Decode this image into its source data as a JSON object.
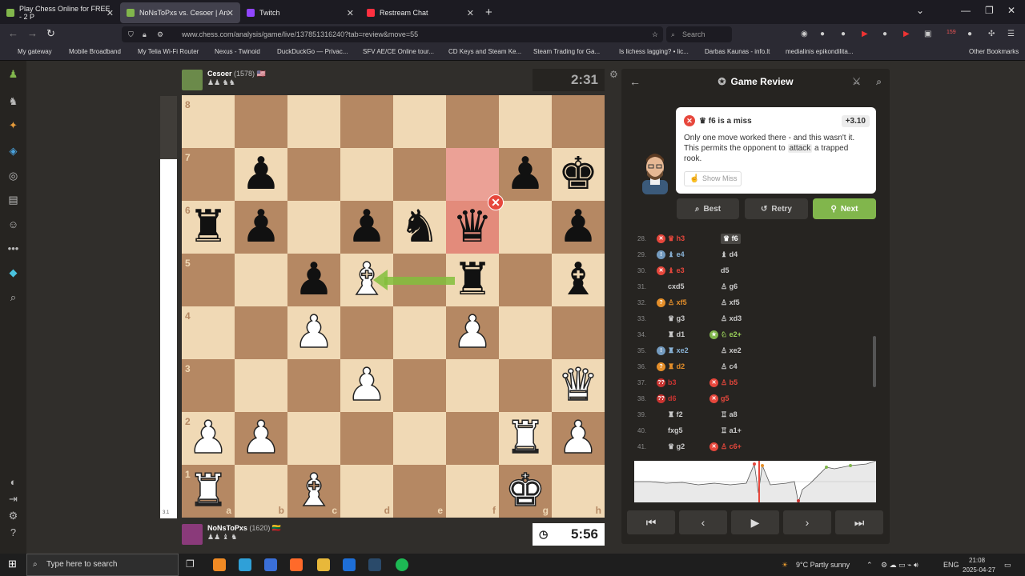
{
  "browser": {
    "tabs": [
      {
        "label": "Play Chess Online for FREE - 2 P",
        "active": false,
        "favicon_color": "#81b64c"
      },
      {
        "label": "NoNsToPxs vs. Cesoer | An",
        "active": true,
        "favicon_color": "#81b64c"
      },
      {
        "label": "Twitch",
        "active": false,
        "favicon_color": "#9146ff"
      },
      {
        "label": "Restream Chat",
        "active": false,
        "favicon_color": "#ff3040"
      }
    ],
    "new_tab": "+",
    "url": "www.chess.com/analysis/game/live/137851316240?tab=review&move=55",
    "search_placeholder": "Search",
    "bookmarks": [
      "My gateway",
      "Mobile Broadband",
      "My Telia Wi-Fi Router",
      "Nexus - Twinoid",
      "DuckDuckGo — Privac...",
      "SFV AE/CE Online tour...",
      "CD Keys and Steam Ke...",
      "Steam Trading for Ga...",
      "Is lichess lagging? • lic...",
      "Darbas Kaunas - info.lt",
      "medialinis epikondilita...",
      "Other Bookmarks"
    ],
    "toolbar_badge": "159"
  },
  "game": {
    "top_player": {
      "name": "Cesoer",
      "rating": "(1578)",
      "flag": "🇺🇸",
      "material": "♟♟ ♞♞",
      "clock": "2:31"
    },
    "bottom_player": {
      "name": "NoNsToPxs",
      "rating": "(1620)",
      "flag": "🇱🇹",
      "material": "♟♟ ♝ ♞",
      "clock": "5:56"
    },
    "eval_label": "3.1",
    "eval_white_fraction": 0.85,
    "files": [
      "a",
      "b",
      "c",
      "d",
      "e",
      "f",
      "g",
      "h"
    ],
    "ranks": [
      "8",
      "7",
      "6",
      "5",
      "4",
      "3",
      "2",
      "1"
    ],
    "board": [
      "........",
      ".p...Xpk",
      "rp.pnq.p",
      "..pB.r.b",
      "..P..P..",
      "...P...Q",
      "PP....RP",
      "R.B...K."
    ],
    "highlight_squares": [
      "f7",
      "f6"
    ],
    "miss_square": "f6",
    "arrow": {
      "from": "f5",
      "to": "d5"
    }
  },
  "review": {
    "title": "Game Review",
    "bubble": {
      "move": "♛ f6 is a miss",
      "eval": "+3.10",
      "text_before": "Only one move worked there - and this wasn't it. This permits the opponent to ",
      "keyword": "attack",
      "text_after": " a trapped rook.",
      "show_button": "Show Miss"
    },
    "actions": {
      "best": "Best",
      "retry": "Retry",
      "next": "Next"
    },
    "colors": {
      "green": "#81b64c",
      "miss": "#e7473c",
      "blunder": "#ca3431",
      "mistake": "#e58f2a",
      "inaccuracy": "#f7c045",
      "good": "#5c8bb0",
      "great": "#749bbf"
    },
    "moves": [
      {
        "num": "28.",
        "white": "♛ h3",
        "white_mark": "miss",
        "black": "♛ f6",
        "black_mark": "",
        "black_selected": true
      },
      {
        "num": "29.",
        "white": "♝ e4",
        "white_mark": "good",
        "black": "♝ d4",
        "black_mark": ""
      },
      {
        "num": "30.",
        "white": "♝ e3",
        "white_mark": "miss",
        "black": "d5",
        "black_mark": ""
      },
      {
        "num": "31.",
        "white": "cxd5",
        "white_mark": "",
        "black": "♙ g6",
        "black_mark": ""
      },
      {
        "num": "32.",
        "white": "♙ xf5",
        "white_mark": "mistake",
        "black": "♙ xf5",
        "black_mark": ""
      },
      {
        "num": "33.",
        "white": "♛ g3",
        "white_mark": "",
        "black": "♙ xd3",
        "black_mark": ""
      },
      {
        "num": "34.",
        "white": "♜ d1",
        "white_mark": "",
        "black": "♘ e2+",
        "black_mark": "best"
      },
      {
        "num": "35.",
        "white": "♜ xe2",
        "white_mark": "good",
        "black": "♙ xe2",
        "black_mark": ""
      },
      {
        "num": "36.",
        "white": "♜ d2",
        "white_mark": "mistake",
        "black": "♙ c4",
        "black_mark": ""
      },
      {
        "num": "37.",
        "white": "b3",
        "white_mark": "blunder",
        "black": "♙ b5",
        "black_mark": "miss"
      },
      {
        "num": "38.",
        "white": "d6",
        "white_mark": "blunder",
        "black": "g5",
        "black_mark": "miss"
      },
      {
        "num": "39.",
        "white": "♜ f2",
        "white_mark": "",
        "black": "♖ a8",
        "black_mark": ""
      },
      {
        "num": "40.",
        "white": "fxg5",
        "white_mark": "",
        "black": "♖ a1+",
        "black_mark": ""
      },
      {
        "num": "41.",
        "white": "♛ g2",
        "white_mark": "",
        "black": "♙ c6+",
        "black_mark": "miss"
      }
    ],
    "controls": [
      "⏮",
      "‹",
      "▶",
      "›",
      "⏭"
    ]
  },
  "taskbar": {
    "search_placeholder": "Type here to search",
    "weather": "9°C  Partly sunny",
    "lang": "ENG",
    "time": "21:08",
    "date": "2025-04-27"
  }
}
